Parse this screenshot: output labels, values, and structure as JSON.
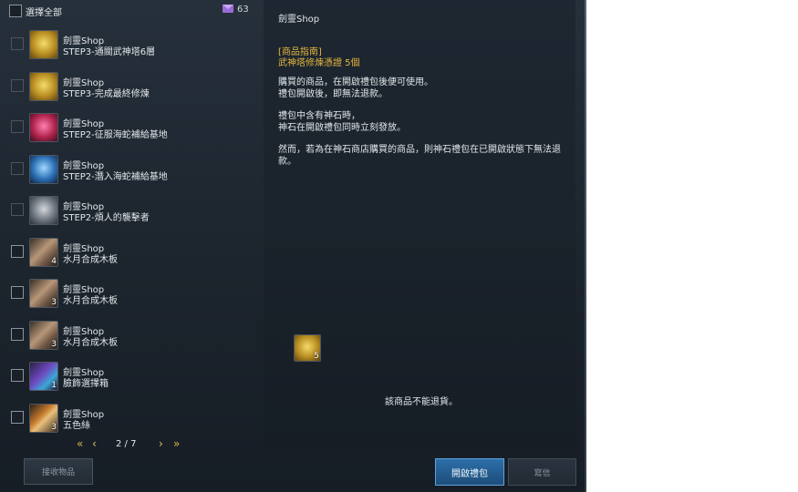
{
  "header": {
    "select_all_label": "選擇全部",
    "mail_count": "63"
  },
  "items": [
    {
      "sender": "劍靈Shop",
      "title": "STEP3-通關武神塔6層",
      "qty": "",
      "icon": "gold-chest-icon",
      "checkbox_enabled": false
    },
    {
      "sender": "劍靈Shop",
      "title": "STEP3-完成最終修煉",
      "qty": "",
      "icon": "gold-chest-icon",
      "checkbox_enabled": false
    },
    {
      "sender": "劍靈Shop",
      "title": "STEP2-征服海蛇補給基地",
      "qty": "",
      "icon": "red-orb-icon",
      "checkbox_enabled": false
    },
    {
      "sender": "劍靈Shop",
      "title": "STEP2-潛入海蛇補給基地",
      "qty": "",
      "icon": "blue-chest-icon",
      "checkbox_enabled": false
    },
    {
      "sender": "劍靈Shop",
      "title": "STEP2-煩人的襲擊者",
      "qty": "",
      "icon": "grey-box-icon",
      "checkbox_enabled": false
    },
    {
      "sender": "劍靈Shop",
      "title": "水月合成木板",
      "qty": "4",
      "icon": "wood-plank-icon",
      "checkbox_enabled": true
    },
    {
      "sender": "劍靈Shop",
      "title": "水月合成木板",
      "qty": "3",
      "icon": "wood-plank-icon",
      "checkbox_enabled": true
    },
    {
      "sender": "劍靈Shop",
      "title": "水月合成木板",
      "qty": "3",
      "icon": "wood-plank-icon",
      "checkbox_enabled": true
    },
    {
      "sender": "劍靈Shop",
      "title": "臉飾選擇箱",
      "qty": "1",
      "icon": "face-accessory-box-icon",
      "checkbox_enabled": true
    },
    {
      "sender": "劍靈Shop",
      "title": "五色絲",
      "qty": "3",
      "icon": "brush-icon",
      "checkbox_enabled": true
    }
  ],
  "pager": {
    "text": "2 / 7"
  },
  "buttons": {
    "receive": "接收物品",
    "open_gift": "開啟禮包",
    "write_mail": "寫信"
  },
  "detail": {
    "sender": "劍靈Shop",
    "guide_header": "[商品指南]",
    "guide_item": "武神塔修煉憑證  5個",
    "paragraphs": [
      "購買的商品，在開啟禮包後便可使用。\n禮包開啟後，即無法退款。",
      "禮包中含有神石時，\n神石在開啟禮包同時立刻發放。",
      "然而，若為在神石商店購買的商品，則神石禮包在已開啟狀態下無法退款。"
    ],
    "attachment_qty": "5",
    "attachment_icon": "gold-chest-icon",
    "no_refund_note": "該商品不能退貨。"
  },
  "colors": {
    "accent_gold": "#e5b63c",
    "primary_button": "#2c6fa8",
    "mail_icon": "#9b6bd8"
  }
}
